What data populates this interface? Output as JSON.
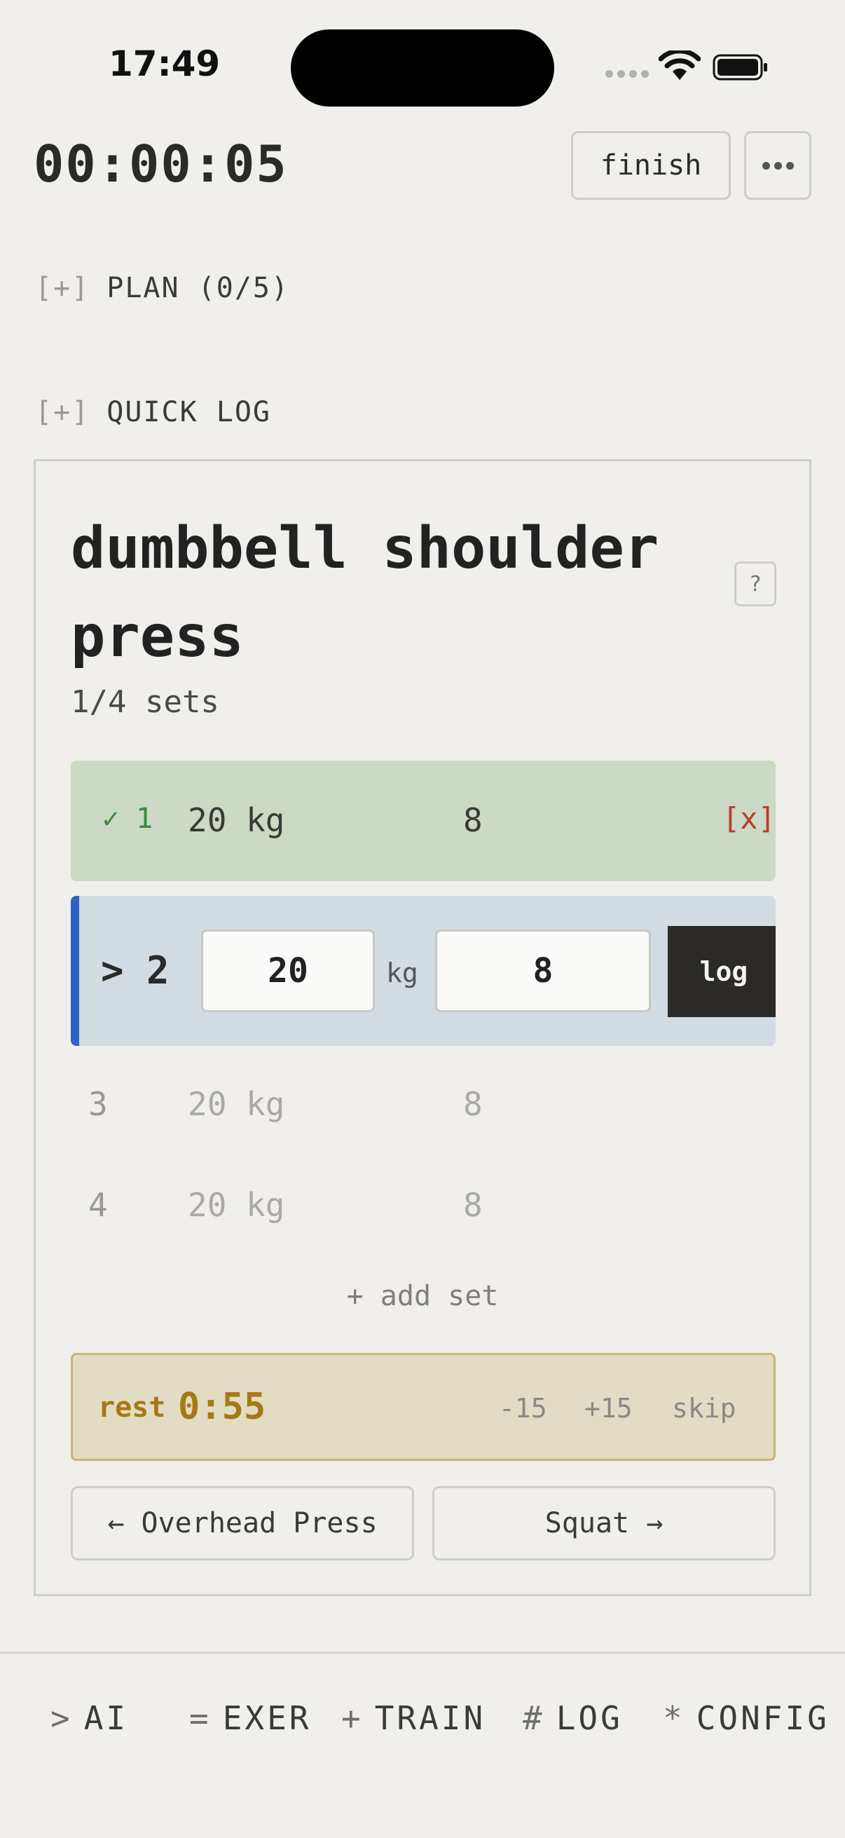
{
  "status_bar": {
    "time": "17:49",
    "signal_icon": "signal-icon",
    "wifi_icon": "wifi-icon",
    "battery_icon": "battery-icon"
  },
  "header": {
    "elapsed": "00:00:05",
    "finish_label": "finish",
    "more_icon": "more-icon"
  },
  "sections": {
    "plan": {
      "toggle": "[+]",
      "label": "PLAN (0/5)"
    },
    "quick_log": {
      "toggle": "[+]",
      "label": "QUICK LOG"
    }
  },
  "exercise": {
    "title": "dumbbell shoulder press",
    "help": "?",
    "sets_summary": "1/4 sets",
    "done_sets": [
      {
        "check": "✓ 1",
        "weight": "20 kg",
        "reps": "8",
        "delete": "[x]"
      }
    ],
    "active_set": {
      "number": "> 2",
      "weight": "20",
      "unit": "kg",
      "reps": "8",
      "log_label": "log"
    },
    "pending_sets": [
      {
        "number": "3",
        "weight": "20 kg",
        "reps": "8"
      },
      {
        "number": "4",
        "weight": "20 kg",
        "reps": "8"
      }
    ],
    "add_set": "+ add set"
  },
  "rest": {
    "label": "rest",
    "time": "0:55",
    "minus": "-15",
    "plus": "+15",
    "skip": "skip"
  },
  "navigation": {
    "prev": "← Overhead Press",
    "next": "Squat →"
  },
  "tabs": [
    {
      "symbol": ">",
      "label": "AI"
    },
    {
      "symbol": "=",
      "label": "EXER"
    },
    {
      "symbol": "+",
      "label": "TRAIN"
    },
    {
      "symbol": "#",
      "label": "LOG"
    },
    {
      "symbol": "*",
      "label": "CONFIG"
    }
  ],
  "colors": {
    "accent_blue": "#2e63c1",
    "done_green": "#cbd9c5",
    "rest_gold": "#a57a14",
    "delete_red": "#c0392b"
  }
}
